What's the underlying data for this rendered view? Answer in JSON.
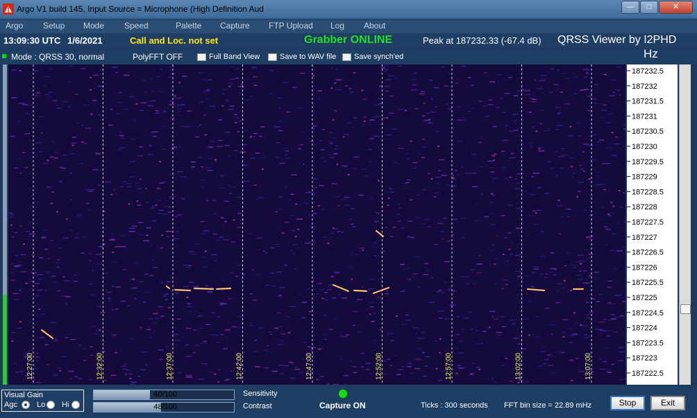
{
  "window": {
    "title": "Argo V1 build 145, Input Source = Microphone (High Definition Aud",
    "minimize": "—",
    "maximize": "□",
    "close": "✕"
  },
  "menu": [
    "Argo",
    "Setup",
    "Mode",
    "Speed",
    "Palette",
    "Capture",
    "FTP Upload",
    "Log",
    "About"
  ],
  "status": {
    "utc_time": "13:09:30 UTC",
    "date": "1/6/2021",
    "call_loc": "Call and Loc. not set",
    "grabber": "Grabber ONLINE",
    "peak": "Peak at   187232.33 (-67.4 dB)",
    "viewer": "QRSS Viewer by I2PHD",
    "hz": "Hz"
  },
  "modebar": {
    "mode": "Mode : QRSS 30, normal",
    "polyfft": "PolyFFT OFF",
    "full_band": "Full Band View",
    "save_wav": "Save to WAV file",
    "save_synched": "Save synch'ed"
  },
  "time_labels": [
    "12:27:00",
    "12:32:00",
    "12:37:00",
    "12:42:00",
    "12:47:00",
    "12:52:00",
    "12:57:00",
    "13:02:00",
    "13:07:00"
  ],
  "freq_labels": [
    "187232.5",
    "187232",
    "187231.5",
    "187231",
    "187230.5",
    "187230",
    "187229.5",
    "187229",
    "187228.5",
    "187228",
    "187227.5",
    "187227",
    "187226.5",
    "187226",
    "187225.5",
    "187225",
    "187224.5",
    "187224",
    "187223.5",
    "187223",
    "187222.5"
  ],
  "bottom": {
    "visual_gain": "Visual Gain",
    "agc": "Agc",
    "lo": "Lo",
    "hi": "Hi",
    "sensitivity_value": "40/100",
    "sensitivity_label": "Sensitivity",
    "sensitivity_level": 0.4,
    "contrast_value": "48/100",
    "contrast_label": "Contrast",
    "contrast_level": 0.48,
    "capture": "Capture ON",
    "ticks": "Ticks   : 300 seconds",
    "fft_bin": "FFT bin size = 22.89 mHz",
    "stop": "Stop",
    "exit": "Exit"
  },
  "colors": {
    "waterfall_bg": "#140a3c",
    "grid": "#ffffff",
    "accent_green": "#22e022",
    "call_yellow": "#ffea00",
    "time_yellow": "#ffff66"
  }
}
